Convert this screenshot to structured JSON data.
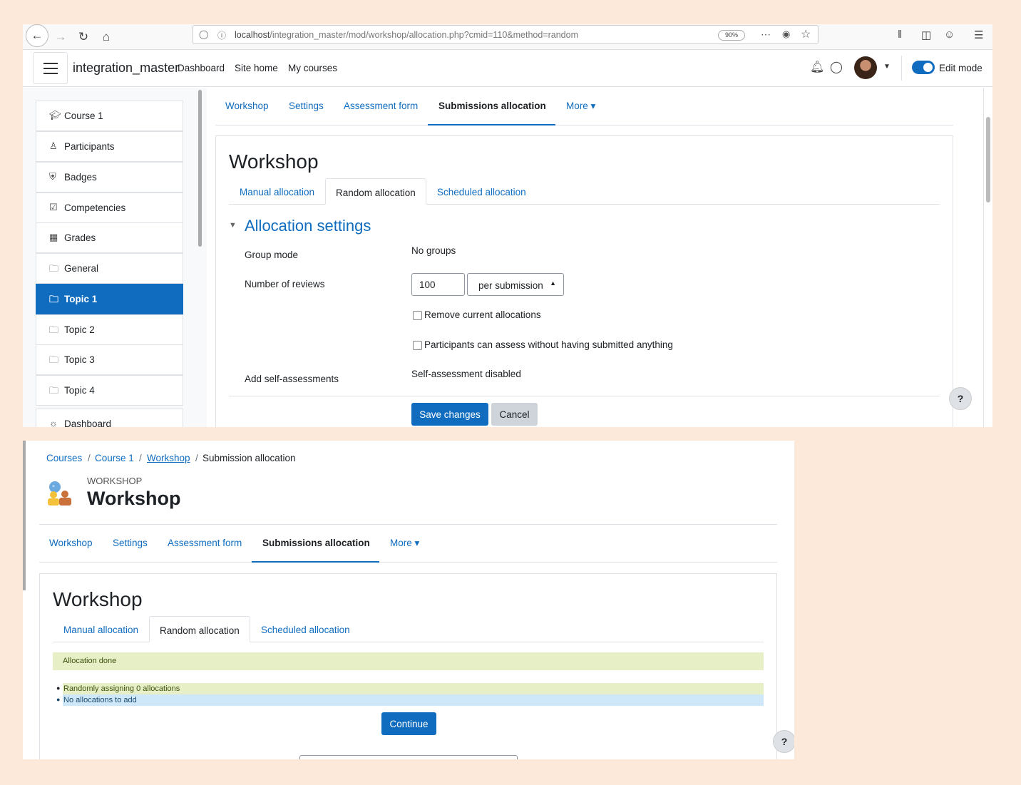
{
  "browser": {
    "url_host": "localhost",
    "url_path": "/integration_master/mod/workshop/allocation.php?cmid=110&method=random",
    "zoom": "90%"
  },
  "navbar": {
    "brand": "integration_master",
    "links": [
      "Dashboard",
      "Site home",
      "My courses"
    ],
    "edit_mode": "Edit mode"
  },
  "course_index": [
    "Course 1",
    "Participants",
    "Badges",
    "Competencies",
    "Grades",
    "General",
    "Topic 1",
    "Topic 2",
    "Topic 3",
    "Topic 4",
    "Dashboard"
  ],
  "tabs": [
    "Workshop",
    "Settings",
    "Assessment form",
    "Submissions allocation",
    "More"
  ],
  "page_title": "Workshop",
  "subtabs": [
    "Manual allocation",
    "Random allocation",
    "Scheduled allocation"
  ],
  "settings": {
    "heading": "Allocation settings",
    "group_mode_label": "Group mode",
    "group_mode_value": "No groups",
    "reviews_label": "Number of reviews",
    "reviews_value": "100",
    "reviews_select": "per submission",
    "remove_current": "Remove current allocations",
    "assess_without": "Participants can assess without having submitted anything",
    "self_label": "Add self-assessments",
    "self_value": "Self-assessment disabled",
    "save": "Save changes",
    "cancel": "Cancel"
  },
  "help": "?",
  "breadcrumb": [
    "Courses",
    "Course 1",
    "Workshop",
    "Submission allocation"
  ],
  "header": {
    "kicker": "WORKSHOP",
    "title": "Workshop"
  },
  "result": {
    "done": "Allocation done",
    "items": [
      "Randomly assigning 0 allocations",
      "No allocations to add"
    ],
    "continue": "Continue"
  }
}
